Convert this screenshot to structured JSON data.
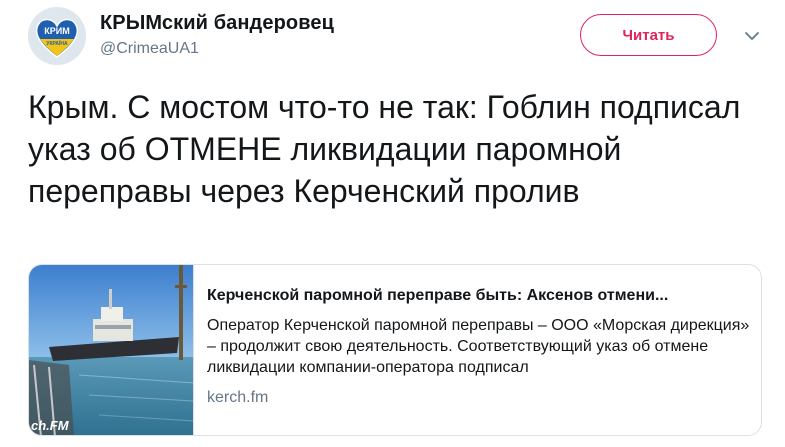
{
  "author": {
    "display_name": "КРЫМский бандеровец",
    "handle": "@CrimeaUA1",
    "avatar_icon": "crimea-heart-logo-icon",
    "avatar_logo_text": "КРИМ",
    "avatar_logo_subtext": "УКРАЇНА"
  },
  "follow_button": {
    "label": "Читать",
    "color": "#e0245e"
  },
  "menu": {
    "icon": "chevron-down-icon"
  },
  "tweet": {
    "text": "Крым. С мостом что-то не так: Гоблин подписал указ об ОТМЕНЕ ликвидации паромной переправы через Керченский пролив"
  },
  "card": {
    "image_icon": "ferry-photo-image",
    "image_watermark": "ch.FM",
    "title": "Керченской паромной переправе быть: Аксенов отмени...",
    "description": "Оператор Керченской паромной переправы – ООО «Морская дирекция» – продолжит свою деятельность. Соответствующий указ об отмене ликвидации компании-оператора подписал",
    "domain": "kerch.fm"
  },
  "colors": {
    "text_primary": "#14171a",
    "text_secondary": "#657786",
    "border": "#d9e0e6",
    "accent": "#e0245e"
  }
}
